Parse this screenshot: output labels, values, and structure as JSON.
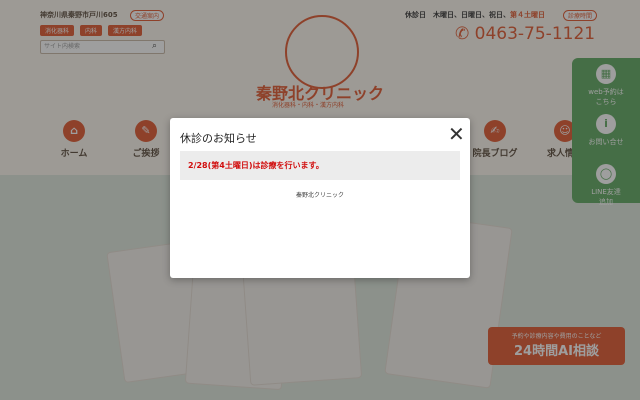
{
  "header": {
    "address": "神奈川県秦野市戸川605",
    "access_label": "交通案内",
    "tags": [
      "消化器科",
      "内科",
      "漢方内科"
    ],
    "search_placeholder": "サイト内検索",
    "logo_name": "秦野北クリニック",
    "logo_sub": "消化器科・内科・漢方内科",
    "closed_prefix": "休診日　木曜日、日曜日、祝日、",
    "closed_red": "第４土曜日",
    "closed_btn": "診療時間",
    "phone": "0463-75-1121"
  },
  "nav": [
    {
      "label": "ホーム",
      "icon": "home-icon"
    },
    {
      "label": "ご挨拶",
      "icon": "greeting-icon"
    },
    {
      "label": "院長ブログ",
      "icon": "blog-icon"
    },
    {
      "label": "求人情報",
      "icon": "person-icon"
    }
  ],
  "side": [
    {
      "label1": "web予約は",
      "label2": "こちら",
      "icon": "calendar-icon"
    },
    {
      "label1": "お問い合せ",
      "label2": "",
      "icon": "info-icon"
    },
    {
      "label1": "LINE友達",
      "label2": "追加",
      "icon": "line-icon"
    }
  ],
  "ai_banner": {
    "small": "予約や診療内容や費用のことなど",
    "big": "24時間AI相談"
  },
  "modal": {
    "title": "休診のお知らせ",
    "notice": "2/28(第4土曜日)は診療を行います。",
    "footer": "秦野北クリニック",
    "close": "✕"
  },
  "colors": {
    "accent": "#e2562c",
    "side_green": "#5ea85f",
    "notice_red": "#d10d0d"
  }
}
